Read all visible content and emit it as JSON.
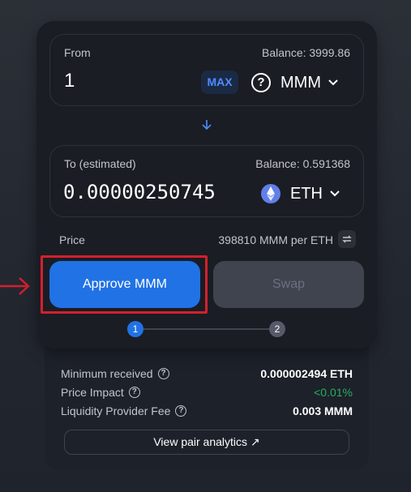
{
  "from": {
    "label": "From",
    "balance": "Balance: 3999.86",
    "amount": "1",
    "max_label": "MAX",
    "token": "MMM",
    "token_icon": "question-circle-icon"
  },
  "to": {
    "label": "To (estimated)",
    "balance": "Balance: 0.591368",
    "amount": "0.00000250745",
    "token": "ETH",
    "token_icon": "eth-icon"
  },
  "price": {
    "label": "Price",
    "value": "398810 MMM per ETH"
  },
  "actions": {
    "approve_label": "Approve MMM",
    "swap_label": "Swap"
  },
  "steps": [
    "1",
    "2"
  ],
  "details": {
    "rows": [
      {
        "key": "Minimum received",
        "value": "0.000002494 ETH"
      },
      {
        "key": "Price Impact",
        "value": "<0.01%"
      },
      {
        "key": "Liquidity Provider Fee",
        "value": "0.003 MMM"
      }
    ],
    "analytics_label": "View pair analytics ↗"
  },
  "colors": {
    "accent": "#2172e5",
    "highlight": "#d3202f",
    "positive": "#27ae60"
  }
}
